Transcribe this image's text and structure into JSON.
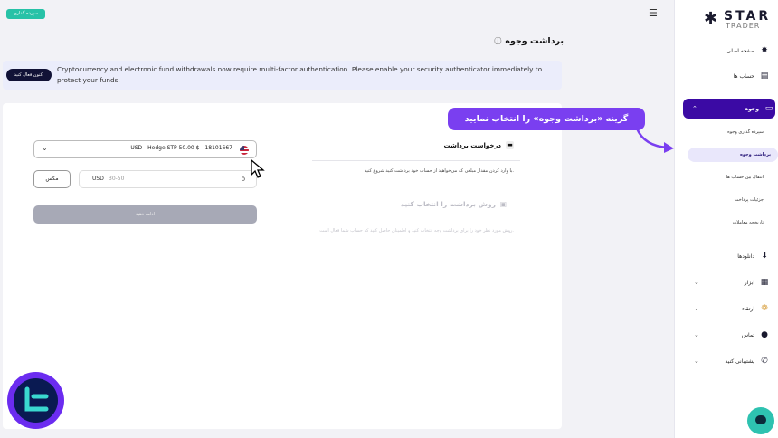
{
  "top": {
    "deposit_button": "سپرده گذاری",
    "page_title": "برداشت وجوه"
  },
  "alert": {
    "text": "Cryptocurrency and electronic fund withdrawals now require multi-factor authentication. Please enable your security authenticator immediately to protect your funds.",
    "button": "اکنون فعال کنید"
  },
  "sidebar": {
    "brand_star": "STAR",
    "brand_trader": "TRADER",
    "items": [
      {
        "label": "صفحه اصلی",
        "icon": "home-icon"
      },
      {
        "label": "حساب ها",
        "icon": "accounts-icon"
      },
      {
        "label": "وجوه",
        "icon": "wallet-icon"
      },
      {
        "label": "دانلودها",
        "icon": "download-icon"
      },
      {
        "label": "ابزار",
        "icon": "tools-icon"
      },
      {
        "label": "ارتقاء",
        "icon": "upgrade-icon"
      },
      {
        "label": "تماس",
        "icon": "contact-icon"
      },
      {
        "label": "پشتیبانی کنید",
        "icon": "phone-icon"
      }
    ],
    "sub_items": [
      "سپرده گذاری وجوه",
      "برداشت وجوه",
      "انتقال بین حساب ها",
      "جزئیات پرداخت",
      "تاریخچه معاملات"
    ]
  },
  "form": {
    "section_title": "درخواست برداشت",
    "section_desc": "با وارد کردن مقدار مبلغی که می‌خواهید از حساب خود برداشت کنید شروع کنید.",
    "method_title": "روش برداشت را انتخاب کنید",
    "method_desc": "روش مورد نظر خود را برای برداشت وجه انتخاب کنید و اطمینان حاصل کنید که حساب شما فعال است.",
    "account_select": "USD - Hedge STP 50.00 $ - 18101667",
    "max_button": "مکس",
    "amount_value": "0",
    "amount_currency": "USD",
    "amount_range": "30-50",
    "continue_button": "ادامه دهید"
  },
  "overlay": {
    "callout": "گزینه «برداشت وجوه» را انتخاب نمایید"
  },
  "colors": {
    "accent": "#3b0aa4",
    "callout": "#7a3ff0",
    "deposit": "#27c2a7"
  }
}
